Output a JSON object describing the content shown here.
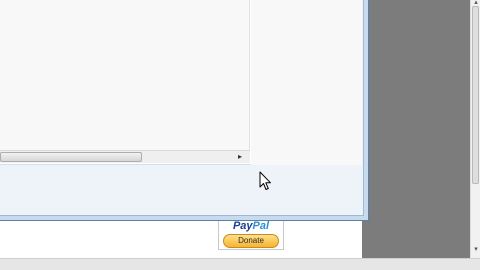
{
  "paypal": {
    "logo_pay": "Pay",
    "logo_pal": "Pal",
    "button_label": "Donate"
  },
  "icons": {
    "scroll_right": "scroll-right-arrow-icon",
    "scroll_up": "scroll-up-arrow-icon",
    "scroll_down": "scroll-down-arrow-icon",
    "cursor": "mouse-pointer-icon"
  },
  "colors": {
    "dialog_frame": "#c8dbee",
    "gray_side": "#7c7c7c",
    "paypal_button": "#f6b530"
  }
}
